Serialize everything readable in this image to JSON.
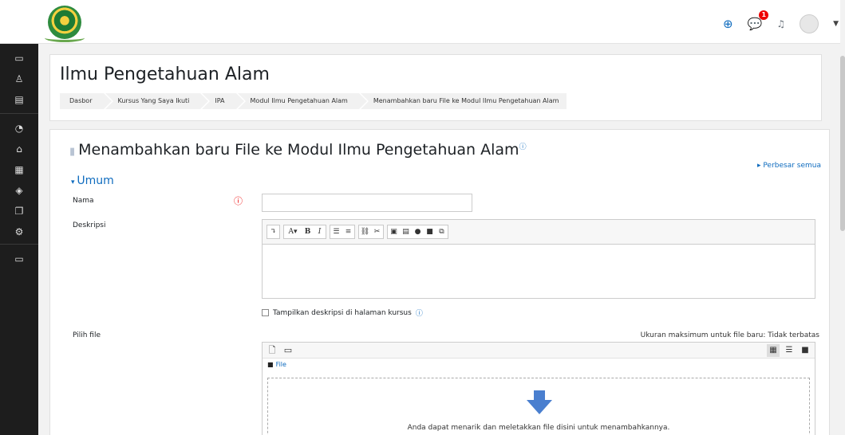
{
  "header": {
    "title": "Ilmu Pengetahuan Alam",
    "breadcrumb": [
      "Dasbor",
      "Kursus Yang Saya Ikuti",
      "IPA",
      "Modul Ilmu Pengetahuan Alam",
      "Menambahkan baru File ke Modul Ilmu Pengetahuan Alam"
    ]
  },
  "navbar": {
    "notification_count": "1",
    "icons": [
      "globe-icon",
      "message-icon",
      "bell-icon",
      "avatar",
      "chevron-down-icon"
    ]
  },
  "rail": {
    "icons": [
      "menu-icon",
      "folder-icon",
      "users-icon",
      "book-icon",
      "gauge-icon",
      "home-icon",
      "calendar-icon",
      "grad-cap-icon",
      "files-icon",
      "settings-icon",
      "folder-icon"
    ]
  },
  "form": {
    "title": "Menambahkan baru File ke Modul Ilmu Pengetahuan Alam",
    "expand_all": "▸ Perbesar semua",
    "section": "Umum",
    "name_label": "Nama",
    "description_label": "Deskripsi",
    "show_description": "Tampilkan deskripsi di halaman kursus",
    "file_label": "Pilih file",
    "max_size": "Ukuran maksimum untuk file baru: Tidak terbatas",
    "file_path": "File",
    "drop_text": "Anda dapat menarik dan meletakkan file disini untuk menambahkannya."
  },
  "colors": {
    "accent": "#0f6cbf",
    "rail": "#1d1d1d",
    "required": "#e00000"
  }
}
